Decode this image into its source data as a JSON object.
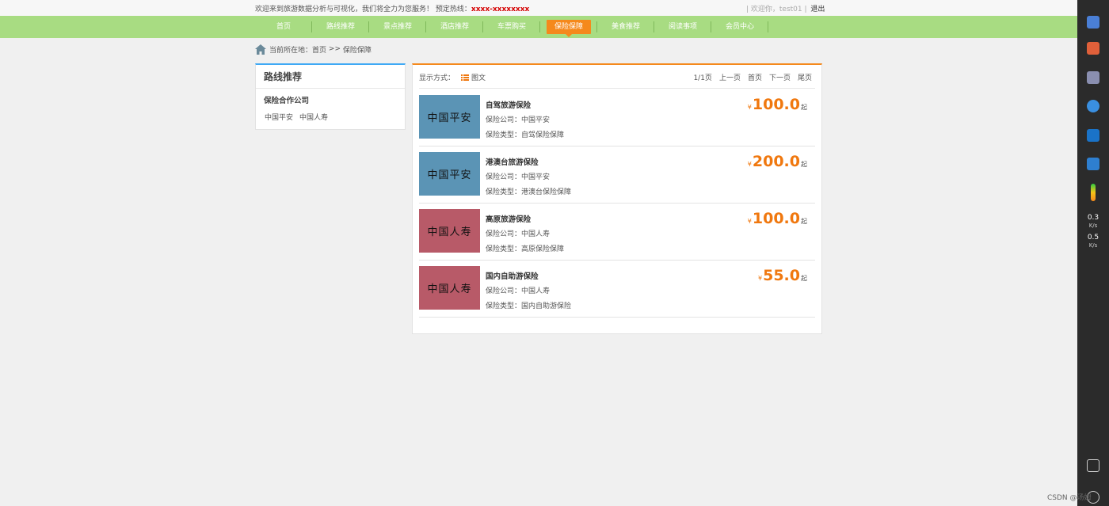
{
  "topbar": {
    "welcome": "欢迎来到旅游数据分析与可视化，我们将全力为您服务！",
    "hotline_label": "预定热线：",
    "hotline": "xxxx-xxxxxxxx",
    "user_greeting": "| 欢迎你，test01 |",
    "logout": "退出"
  },
  "nav": {
    "items": [
      "首页",
      "路线推荐",
      "景点推荐",
      "酒店推荐",
      "车票购买",
      "保险保障",
      "美食推荐",
      "阅读事项",
      "会员中心"
    ],
    "active": "保险保障"
  },
  "breadcrumb": {
    "label": "当前所在地：",
    "home": "首页",
    "separator": ">>",
    "current": "保险保障"
  },
  "sidebar": {
    "title": "路线推荐",
    "subtitle": "保险合作公司",
    "companies": [
      "中国平安",
      "中国人寿"
    ]
  },
  "toolbar": {
    "display_label": "显示方式：",
    "display_mode": "图文",
    "pager": [
      "1/1页",
      "上一页",
      "首页",
      "下一页",
      "尾页"
    ]
  },
  "products": [
    {
      "thumb": "中国平安",
      "name": "自驾旅游保险",
      "company": "保险公司：中国平安",
      "type": "保险类型：自驾保险保障",
      "yen": "¥",
      "price": "100.0",
      "suffix": "起"
    },
    {
      "thumb": "中国平安",
      "name": "港澳台旅游保险",
      "company": "保险公司：中国平安",
      "type": "保险类型：港澳台保险保障",
      "yen": "¥",
      "price": "200.0",
      "suffix": "起"
    },
    {
      "thumb": "中国人寿",
      "name": "高原旅游保险",
      "company": "保险公司：中国人寿",
      "type": "保险类型：高原保险保障",
      "yen": "¥",
      "price": "100.0",
      "suffix": "起"
    },
    {
      "thumb": "中国人寿",
      "name": "国内自助游保险",
      "company": "保险公司：中国人寿",
      "type": "保险类型：国内自助游保险",
      "yen": "¥",
      "price": "55.0",
      "suffix": "起"
    }
  ],
  "system_tray": {
    "upload_speed": "0.3",
    "upload_unit": "K/s",
    "download_speed": "0.5",
    "download_unit": "K/s"
  },
  "watermark": "CSDN @汤姆",
  "colors": {
    "nav_bg": "#a8dc82",
    "accent_orange": "#f5891c",
    "price_orange": "#f0780f",
    "sidebar_accent": "#3fa9f5",
    "hotline_red": "#d40000",
    "pingan_blue": "#5b94b5",
    "renshou_red": "#b85a68"
  }
}
